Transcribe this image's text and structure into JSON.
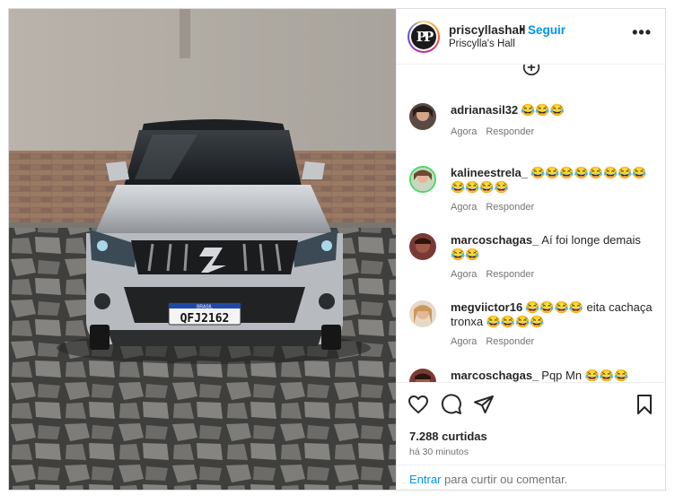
{
  "post": {
    "plate_text": "QFJ2162",
    "plate_header": "BRASIL"
  },
  "header": {
    "username": "priscyllashall",
    "separator": "•",
    "follow_label": "Seguir",
    "subtitle": "Priscylla's Hall",
    "avatar_initials": "PP",
    "more_label": "•••"
  },
  "comments": [
    {
      "username": "adrianasil32",
      "text": "😂😂😂",
      "time": "Agora",
      "reply": "Responder"
    },
    {
      "username": "kalineestrela_",
      "text": "😂😂😂😂😂😂😂😂😂😂😂😂",
      "time": "Agora",
      "reply": "Responder"
    },
    {
      "username": "marcoschagas_",
      "text": "Aí foi longe demais 😂😂",
      "time": "Agora",
      "reply": "Responder"
    },
    {
      "username": "megviictor16",
      "text": "😂😂😂😂 eita cachaça tronxa 😂😂😂😂",
      "time": "Agora",
      "reply": "Responder"
    },
    {
      "username": "marcoschagas_",
      "text": "Pqp Mn 😂😂😂",
      "time": "",
      "reply": ""
    }
  ],
  "actions": {
    "likes": "7.288 curtidas",
    "time_ago": "há 30 minutos"
  },
  "footer": {
    "login_link": "Entrar",
    "rest": " para curtir ou comentar."
  },
  "colors": {
    "accent": "#0095f6",
    "text": "#262626",
    "muted": "#737373",
    "border": "#dbdbdb"
  }
}
